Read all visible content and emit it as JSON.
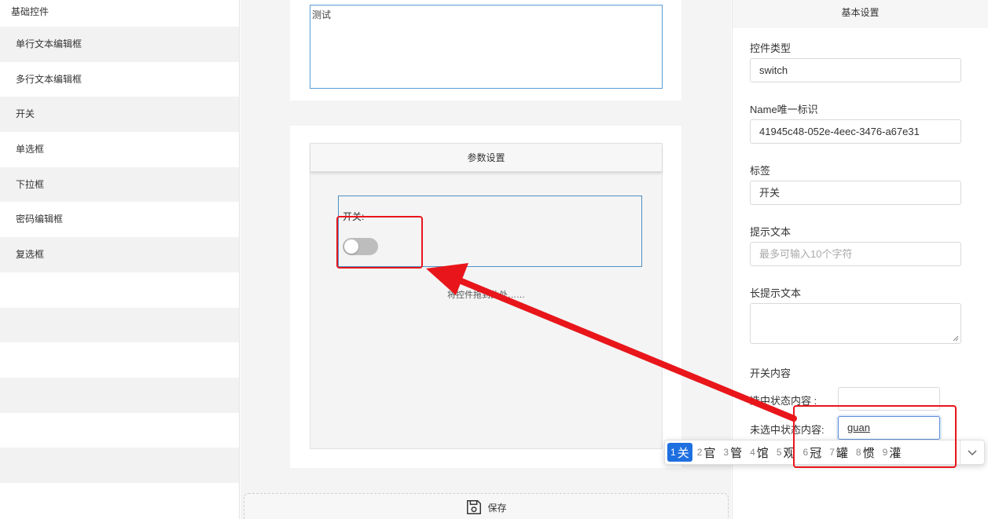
{
  "sidebar": {
    "title": "基础控件",
    "items": [
      {
        "label": "单行文本编辑框"
      },
      {
        "label": "多行文本编辑框"
      },
      {
        "label": "开关"
      },
      {
        "label": "单选框"
      },
      {
        "label": "下拉框"
      },
      {
        "label": "密码编辑框"
      },
      {
        "label": "复选框"
      }
    ]
  },
  "canvas": {
    "textarea_value": "测试",
    "param_title": "参数设置",
    "switch_label": "开关:",
    "switch_checked": false,
    "drop_hint": "将控件拖到此处……",
    "save_label": "保存"
  },
  "right_panel": {
    "title": "基本设置",
    "control_type_label": "控件类型",
    "control_type_value": "switch",
    "name_label": "Name唯一标识",
    "name_value": "41945c48-052e-4eec-3476-a67e31",
    "tag_label": "标签",
    "tag_value": "开关",
    "hint_label": "提示文本",
    "hint_placeholder": "最多可输入10个字符",
    "long_hint_label": "长提示文本",
    "switch_content_label": "开关内容",
    "checked_label": "选中状态内容 :",
    "checked_value": "",
    "unchecked_label": "未选中状态内容:",
    "unchecked_value": "guan"
  },
  "ime": {
    "candidates": [
      {
        "num": "1",
        "char": "关"
      },
      {
        "num": "2",
        "char": "官"
      },
      {
        "num": "3",
        "char": "管"
      },
      {
        "num": "4",
        "char": "馆"
      },
      {
        "num": "5",
        "char": "观"
      },
      {
        "num": "6",
        "char": "冠"
      },
      {
        "num": "7",
        "char": "罐"
      },
      {
        "num": "8",
        "char": "惯"
      },
      {
        "num": "9",
        "char": "灌"
      }
    ]
  },
  "colors": {
    "annotation_red": "#e8161b",
    "focus_blue": "#4a90c8",
    "ime_selected": "#1e6fe0"
  }
}
